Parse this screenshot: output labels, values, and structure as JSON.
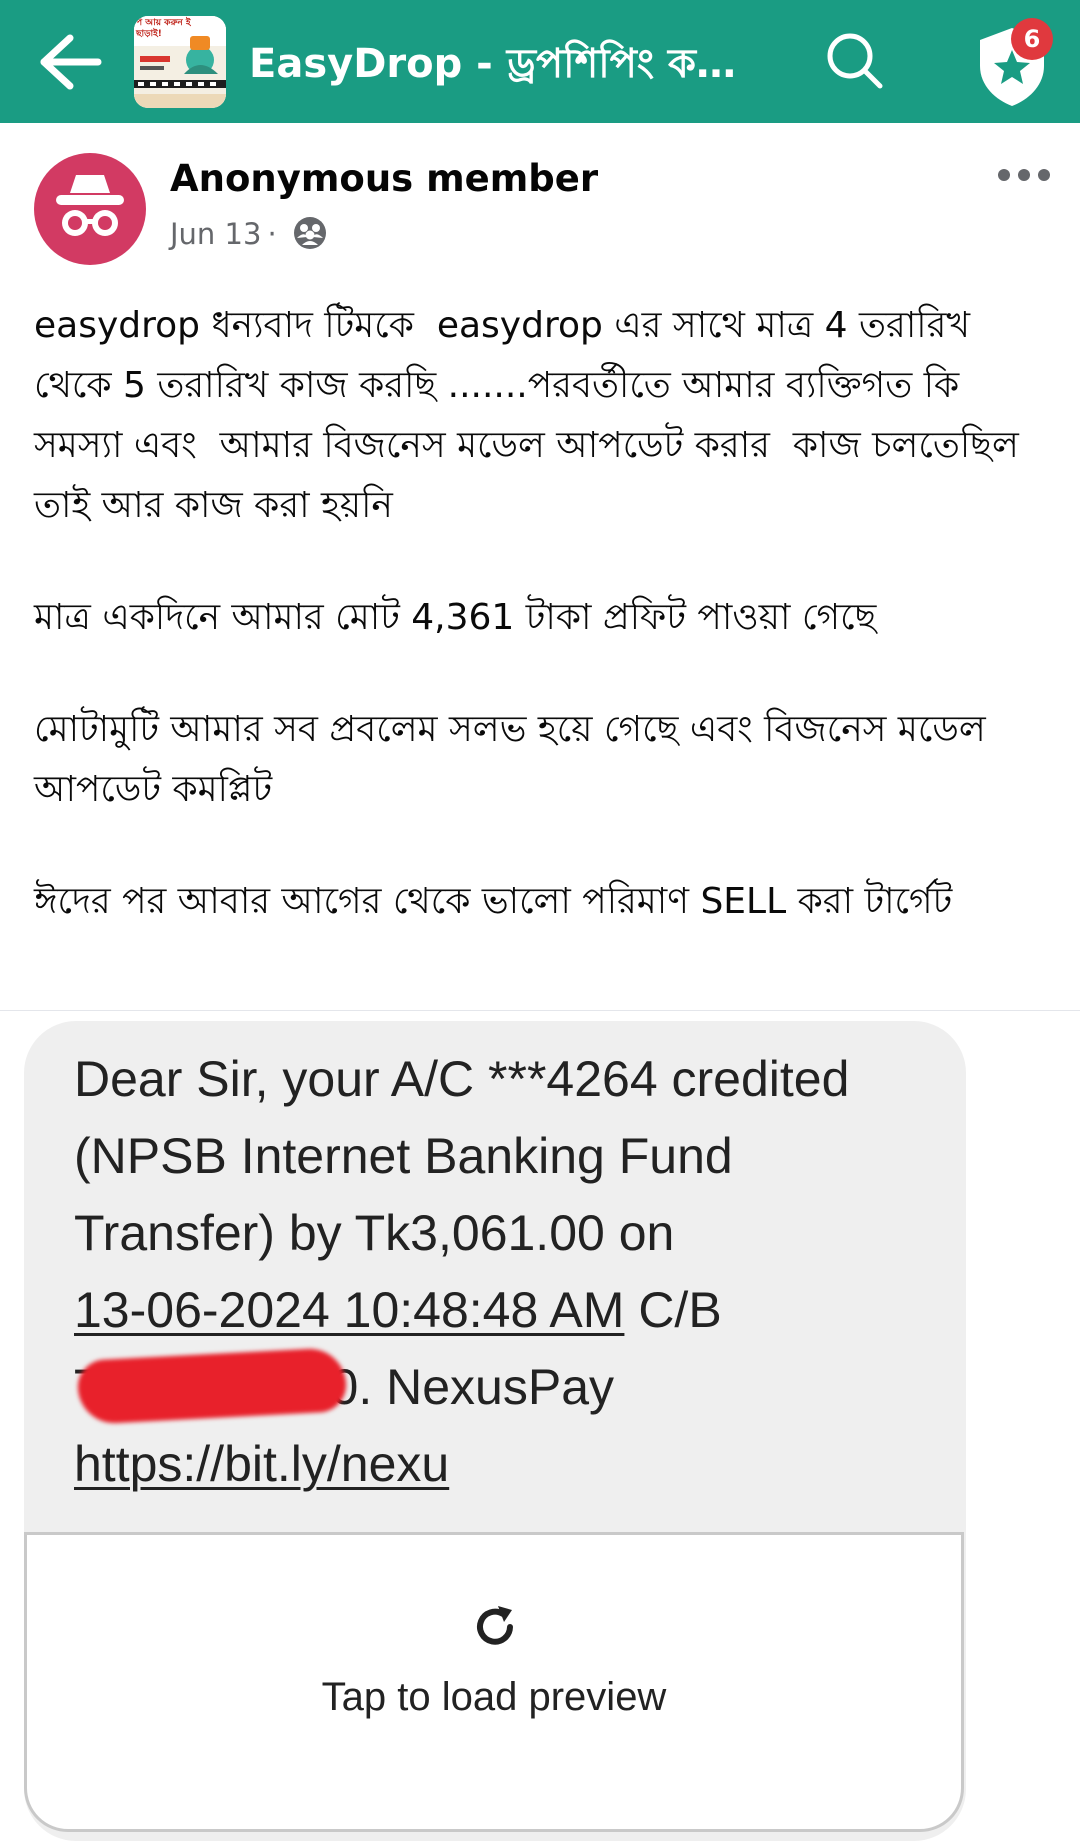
{
  "topbar": {
    "title": "EasyDrop - ড্রপশিপিং করে...",
    "thumbnail_text": "প আয় করুন ই ছাড়াই!",
    "notification_count": "6",
    "colors": {
      "background": "#1a9c83",
      "badge": "#e0393e"
    },
    "icons": [
      "back-arrow-icon",
      "search-icon",
      "shield-star-icon"
    ]
  },
  "post": {
    "author": "Anonymous member",
    "date": "Jun 13",
    "separator": "·",
    "audience_icon": "group-audience-icon",
    "paragraphs": [
      "easydrop ধন্যবাদ টিমকে  easydrop এর সাথে মাত্র 4 তরারিখ থেকে 5 তরারিখ কাজ করছি .......পরবর্তীতে আমার ব্যক্তিগত কি সমস্যা এবং  আমার বিজনেস মডেল আপডেট করার  কাজ চলতেছিল  তাই আর কাজ করা হয়নি",
      "মাত্র একদিনে আমার মোট 4,361 টাকা প্রফিট পাওয়া গেছে",
      "মোটামুটি আমার সব প্রবলেম সলভ হয়ে গেছে এবং বিজনেস মডেল আপডেট কমপ্লিট",
      "ঈদের পর আবার আগের থেকে ভালো পরিমাণ SELL করা টার্গেট"
    ]
  },
  "sms": {
    "line1": "Dear Sir, your A/C ***4264 credited",
    "line2": "(NPSB Internet Banking Fund",
    "line3": "Transfer) by Tk3,061.00 on",
    "line4_datetime": "13-06-2024 10:48:48 AM",
    "line4_rest": " C/B",
    "line5_start": "T",
    "line5_end": "0. NexusPay",
    "line6_link": "https://bit.ly/nexu"
  },
  "preview": {
    "label": "Tap to load preview",
    "icon": "reload-icon"
  }
}
